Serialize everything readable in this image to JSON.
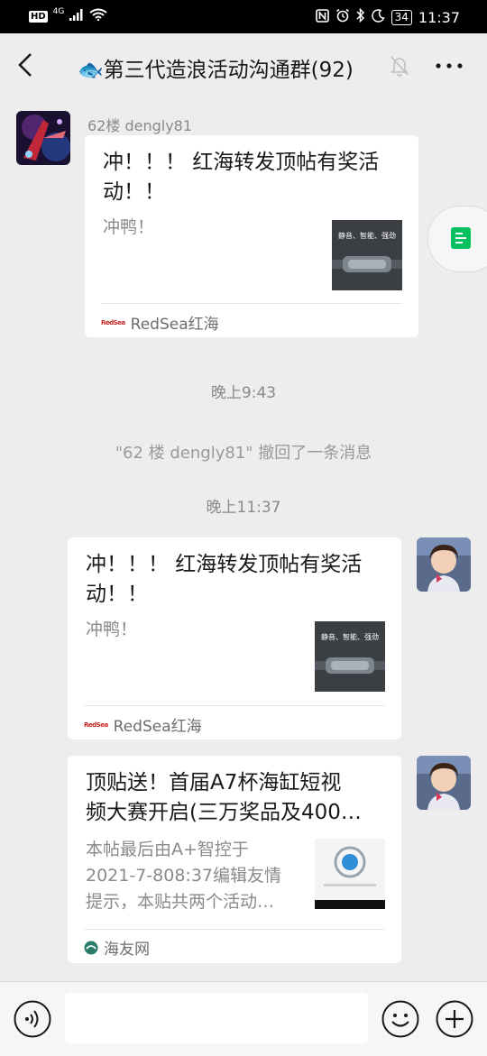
{
  "status_bar": {
    "hd": "HD",
    "network": "4G",
    "battery": "34",
    "time": "11:37"
  },
  "header": {
    "title": "🐟第三代造浪活动沟通群(92)"
  },
  "messages": [
    {
      "sender": "62楼 dengly81",
      "card_title_l1": "冲！！！ 红海转发顶帖有奖活",
      "card_title_l2": "动！！",
      "card_desc": "冲鸭！",
      "thumb_text": "静音、智能、强劲",
      "source_logo": "RedSea",
      "source": "RedSea红海"
    },
    {
      "timestamp": "晚上9:43"
    },
    {
      "system": "\"62 楼 dengly81\" 撤回了一条消息"
    },
    {
      "timestamp": "晚上11:37"
    },
    {
      "card_title_l1": "冲！！！ 红海转发顶帖有奖活",
      "card_title_l2": "动！！",
      "card_desc": "冲鸭！",
      "thumb_text": "静音、智能、强劲",
      "source_logo": "RedSea",
      "source": "RedSea红海"
    },
    {
      "card_title_l1": "顶贴送！首届A7杯海缸短视",
      "card_title_l2": "频大赛开启(三万奖品及400…",
      "card_desc_l1": "本帖最后由A+智控于",
      "card_desc_l2": "2021-7-808:37编辑友情",
      "card_desc_l3": "提示，本贴共两个活动…",
      "source": "海友网"
    }
  ],
  "input": {
    "placeholder": ""
  },
  "colors": {
    "background": "#ededed",
    "card": "#ffffff",
    "text": "#191919",
    "muted": "#8a8a8a",
    "accent_green": "#07c160"
  },
  "icons": [
    "back-arrow-icon",
    "mute-bell-icon",
    "more-dots-icon",
    "doc-icon",
    "voice-icon",
    "emoji-icon",
    "plus-icon"
  ]
}
